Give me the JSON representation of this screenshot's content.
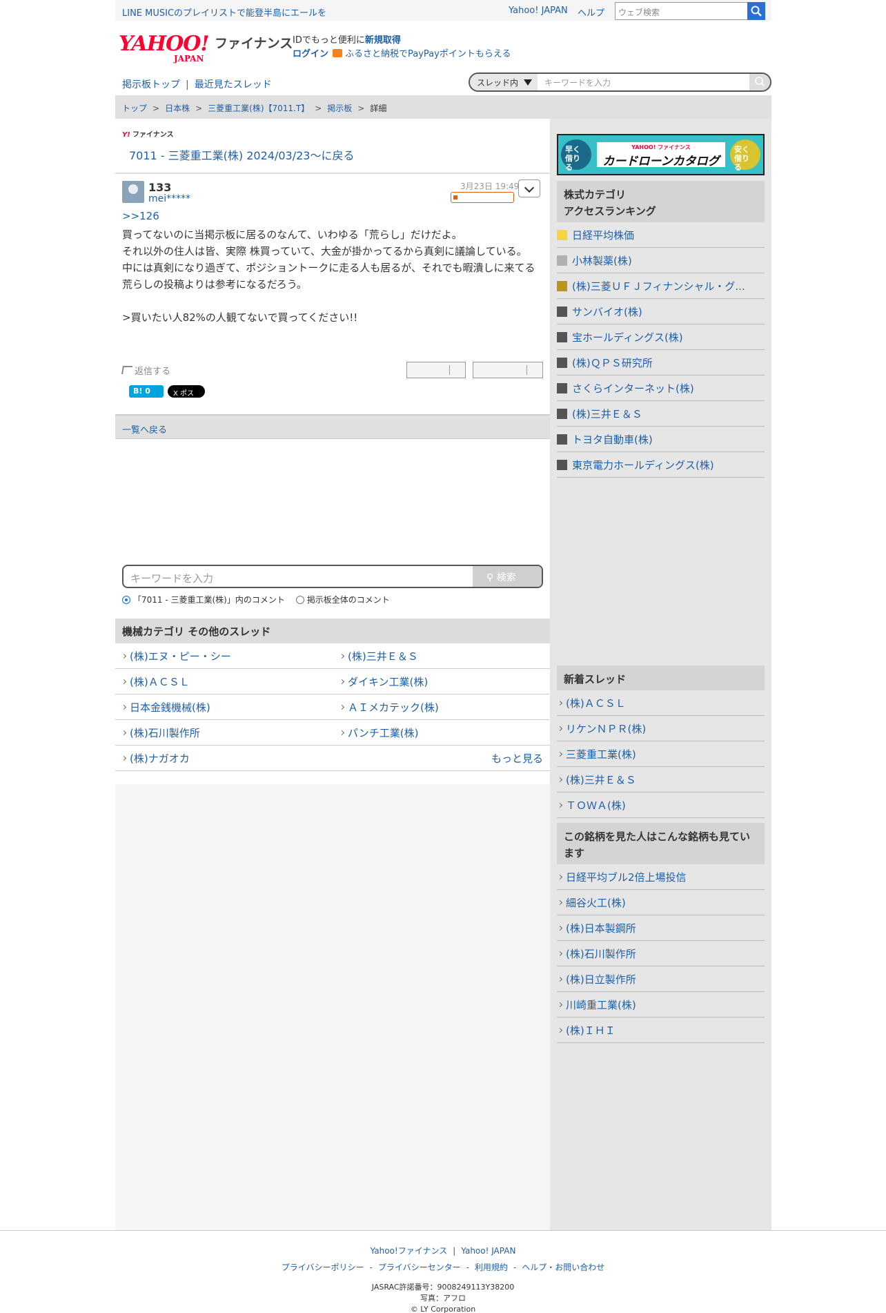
{
  "topbar": {
    "promo": "LINE MUSICのプレイリストで能登半島にエールを",
    "yahoo_japan": "Yahoo! JAPAN",
    "help": "ヘルプ",
    "web_search_placeholder": "ウェブ検索"
  },
  "header": {
    "logo_text": "YAHOO!",
    "logo_sub": "JAPAN",
    "finance": "ファイナンス",
    "id_text": "IDでもっと便利に",
    "register": "新規取得",
    "login": "ログイン",
    "furusato": "ふるさと納税でPayPayポイントもらえる"
  },
  "subnav": {
    "board_top": "掲示板トップ",
    "recent": "最近見たスレッド",
    "scope": "スレッド内",
    "keyword_placeholder": "キーワードを入力"
  },
  "breadcrumb": [
    "トップ",
    "日本株",
    "三菱重工業(株)【7011.T】",
    "掲示板",
    "詳細"
  ],
  "thread": {
    "brand_small": "ファイナンス",
    "back_title": "7011 - 三菱重工業(株) 2024/03/23〜に戻る"
  },
  "post": {
    "number": "133",
    "author": "mei*****",
    "date": "3月23日 19:49",
    "reply_ref": ">>126",
    "body": "買ってないのに当掲示板に居るのなんて、いわゆる「荒らし」だけだよ。\nそれ以外の住人は皆、実際 株買っていて、大金が掛かってるから真剣に議論している。\n中には真剣になり過ぎて、ポジショントークに走る人も居るが、それでも暇潰しに来てる荒らしの投稿よりは参考になるだろう。\n\n>買いたい人82%の人観てないで買ってください!!",
    "reply": "返信する",
    "hatena": "B! 0",
    "x_post": "X ポスト"
  },
  "list_back": "一覧へ戻る",
  "search": {
    "placeholder": "キーワードを入力",
    "button": "検索",
    "radio1": "「7011 - 三菱重工業(株)」内のコメント",
    "radio2": "掲示板全体のコメント"
  },
  "other_threads": {
    "heading": "機械カテゴリ  その他のスレッド",
    "rows": [
      [
        "(株)エヌ・ピー・シー",
        "(株)三井Ｅ＆Ｓ"
      ],
      [
        "(株)ＡＣＳＬ",
        "ダイキン工業(株)"
      ],
      [
        "日本金銭機械(株)",
        "ＡＩメカテック(株)"
      ],
      [
        "(株)石川製作所",
        "パンチ工業(株)"
      ]
    ],
    "last": "(株)ナガオカ",
    "more": "もっと見る"
  },
  "sidebar": {
    "ad": {
      "left": "早く借りる",
      "top": "YAHOO! ファイナンス",
      "main": "カードローンカタログ",
      "right": "安く借りる"
    },
    "ranking_heading1": "株式カテゴリ",
    "ranking_heading2": "アクセスランキング",
    "ranking": [
      {
        "name": "日経平均株価",
        "color": "#f5d642"
      },
      {
        "name": "小林製薬(株)",
        "color": "#b0b0b0"
      },
      {
        "name": "(株)三菱ＵＦＪフィナンシャル・グ...",
        "color": "#b8961e"
      },
      {
        "name": "サンバイオ(株)",
        "color": "#555555"
      },
      {
        "name": "宝ホールディングス(株)",
        "color": "#555555"
      },
      {
        "name": "(株)ＱＰＳ研究所",
        "color": "#555555"
      },
      {
        "name": "さくらインターネット(株)",
        "color": "#555555"
      },
      {
        "name": "(株)三井Ｅ＆Ｓ",
        "color": "#555555"
      },
      {
        "name": "トヨタ自動車(株)",
        "color": "#555555"
      },
      {
        "name": "東京電力ホールディングス(株)",
        "color": "#555555"
      }
    ],
    "new_heading": "新着スレッド",
    "new_threads": [
      "(株)ＡＣＳＬ",
      "リケンＮＰＲ(株)",
      "三菱重工業(株)",
      "(株)三井Ｅ＆Ｓ",
      "ＴＯＷＡ(株)"
    ],
    "also_heading": "この銘柄を見た人はこんな銘柄も見ています",
    "also": [
      "日経平均ブル2倍上場投信",
      "細谷火工(株)",
      "(株)日本製鋼所",
      "(株)石川製作所",
      "(株)日立製作所",
      "川崎重工業(株)",
      "(株)ＩＨＩ"
    ]
  },
  "footer": {
    "yf": "Yahoo!ファイナンス",
    "yj": "Yahoo! JAPAN",
    "privacy": "プライバシーポリシー",
    "privacy_center": "プライバシーセンター",
    "terms": "利用規約",
    "help_contact": "ヘルプ・お問い合わせ",
    "jasrac": "JASRAC許諾番号：9008249113Y38200",
    "photo": "写真：アフロ",
    "copyright": "© LY Corporation"
  }
}
